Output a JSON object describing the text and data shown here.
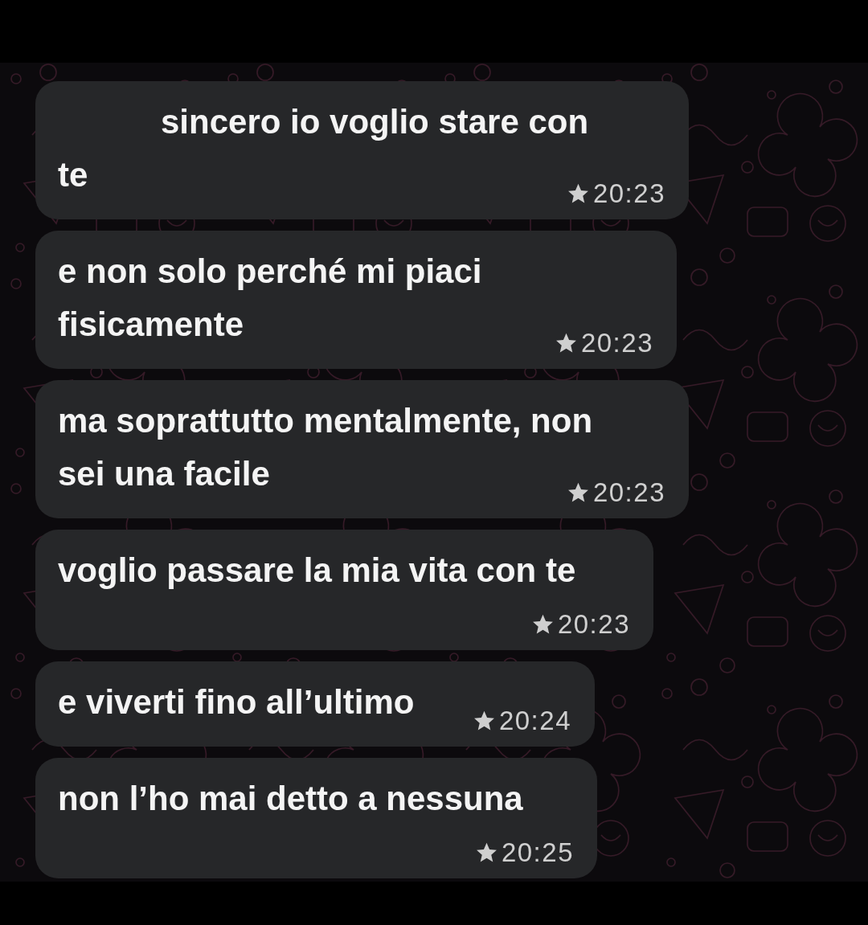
{
  "messages": [
    {
      "kind": "inline",
      "text": "sincero io voglio stare con\nte",
      "first_line_indented": true,
      "starred": true,
      "time": "20:23"
    },
    {
      "kind": "inline",
      "text": "e non solo perché mi piaci\nfisicamente",
      "first_line_indented": false,
      "starred": true,
      "time": "20:23"
    },
    {
      "kind": "inline",
      "text": "ma soprattutto mentalmente, non\nsei una facile",
      "first_line_indented": false,
      "starred": true,
      "time": "20:23"
    },
    {
      "kind": "below",
      "text": "voglio passare la mia vita con te",
      "first_line_indented": false,
      "starred": true,
      "time": "20:23"
    },
    {
      "kind": "inline",
      "text": "e viverti fino all’ultimo",
      "first_line_indented": false,
      "starred": true,
      "time": "20:24"
    },
    {
      "kind": "below",
      "text": "non l’ho mai detto a nessuna",
      "first_line_indented": false,
      "starred": true,
      "time": "20:25"
    }
  ]
}
